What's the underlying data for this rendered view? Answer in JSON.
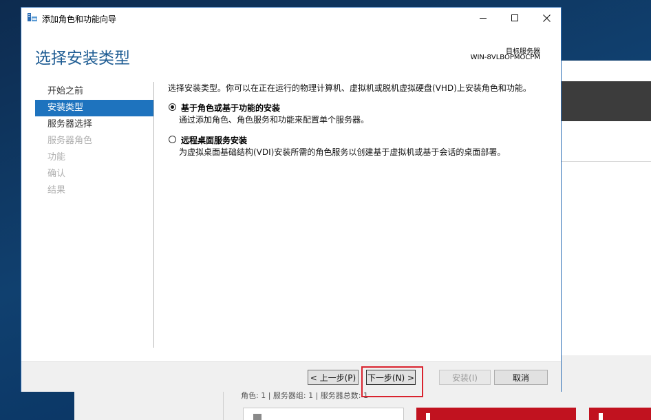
{
  "background": {
    "stats_text": "角色: 1 | 服务器组: 1 | 服务器总数: 1"
  },
  "dialog": {
    "title": "添加角色和功能向导",
    "heading": "选择安装类型",
    "target_label": "目标服务器",
    "target_server": "WIN-8VLBOPMOCPM"
  },
  "nav": {
    "items": [
      {
        "label": "开始之前",
        "state": "normal"
      },
      {
        "label": "安装类型",
        "state": "active"
      },
      {
        "label": "服务器选择",
        "state": "normal"
      },
      {
        "label": "服务器角色",
        "state": "disabled"
      },
      {
        "label": "功能",
        "state": "disabled"
      },
      {
        "label": "确认",
        "state": "disabled"
      },
      {
        "label": "结果",
        "state": "disabled"
      }
    ]
  },
  "content": {
    "intro": "选择安装类型。你可以在正在运行的物理计算机、虚拟机或脱机虚拟硬盘(VHD)上安装角色和功能。",
    "options": [
      {
        "title": "基于角色或基于功能的安装",
        "description": "通过添加角色、角色服务和功能来配置单个服务器。",
        "selected": true
      },
      {
        "title": "远程桌面服务安装",
        "description": "为虚拟桌面基础结构(VDI)安装所需的角色服务以创建基于虚拟机或基于会话的桌面部署。",
        "selected": false
      }
    ]
  },
  "buttons": {
    "previous": "< 上一步(P)",
    "next": "下一步(N) >",
    "install": "安装(I)",
    "cancel": "取消"
  },
  "colors": {
    "accent": "#1e73be",
    "heading": "#1e5c93",
    "highlight": "#d9232e"
  }
}
